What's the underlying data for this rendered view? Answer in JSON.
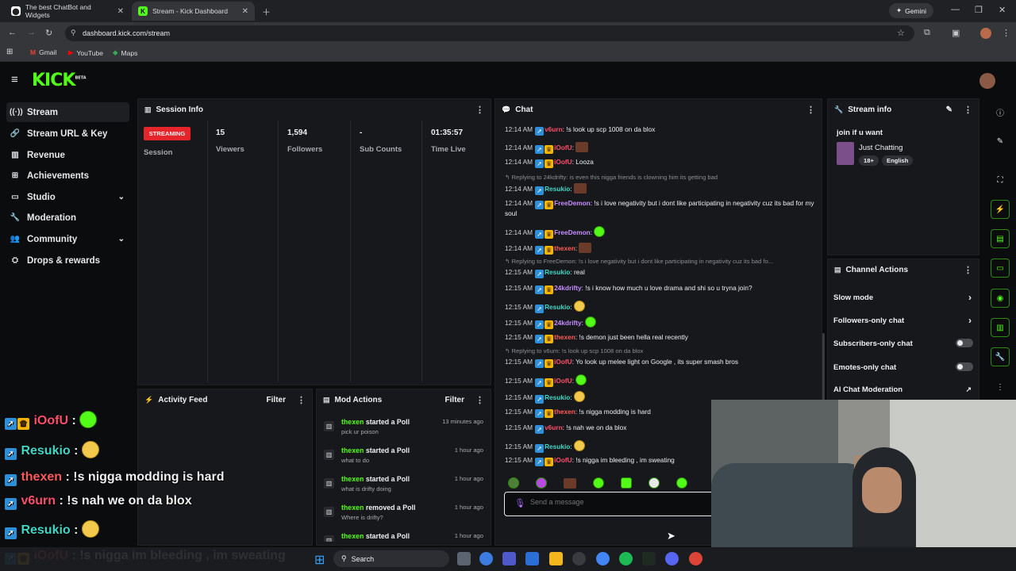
{
  "browser": {
    "tabs": [
      {
        "title": "The best ChatBot and Widgets",
        "active": false
      },
      {
        "title": "Stream - Kick Dashboard",
        "active": true
      }
    ],
    "gemini_label": "Gemini",
    "url": "dashboard.kick.com/stream",
    "bookmarks": [
      "Gmail",
      "YouTube",
      "Maps"
    ]
  },
  "kick": {
    "logo": "KICK",
    "beta": "BETA"
  },
  "sidebar": {
    "items": [
      {
        "label": "Stream",
        "icon": "broadcast-icon",
        "glyph": "((·))",
        "active": true
      },
      {
        "label": "Stream URL & Key",
        "icon": "key-icon",
        "glyph": "🔗"
      },
      {
        "label": "Revenue",
        "icon": "chart-icon",
        "glyph": "▥"
      },
      {
        "label": "Achievements",
        "icon": "trophy-icon",
        "glyph": "⊞"
      },
      {
        "label": "Studio",
        "icon": "studio-icon",
        "glyph": "▭",
        "expandable": true
      },
      {
        "label": "Moderation",
        "icon": "wrench-icon",
        "glyph": "🔧"
      },
      {
        "label": "Community",
        "icon": "people-icon",
        "glyph": "👥",
        "expandable": true
      },
      {
        "label": "Drops & rewards",
        "icon": "gift-icon",
        "glyph": "⛭"
      }
    ]
  },
  "session": {
    "title": "Session Info",
    "status": "STREAMING",
    "status_label": "Session",
    "stats": [
      {
        "value": "15",
        "label": "Viewers"
      },
      {
        "value": "1,594",
        "label": "Followers"
      },
      {
        "value": "-",
        "label": "Sub Counts"
      },
      {
        "value": "01:35:57",
        "label": "Time Live"
      }
    ]
  },
  "activity": {
    "title": "Activity Feed",
    "filter": "Filter"
  },
  "mod_actions": {
    "title": "Mod Actions",
    "filter": "Filter",
    "items": [
      {
        "user": "thexen",
        "action": "started a Poll",
        "detail": "pick ur poison",
        "time": "13 minutes ago"
      },
      {
        "user": "thexen",
        "action": "started a Poll",
        "detail": "what to do",
        "time": "1 hour ago"
      },
      {
        "user": "thexen",
        "action": "started a Poll",
        "detail": "what is drifty doing",
        "time": "1 hour ago"
      },
      {
        "user": "thexen",
        "action": "removed a Poll",
        "detail": "Where is drifty?",
        "time": "1 hour ago"
      },
      {
        "user": "thexen",
        "action": "started a Poll",
        "detail": "",
        "time": "1 hour ago"
      }
    ]
  },
  "chat": {
    "title": "Chat",
    "placeholder": "Send a message",
    "messages": [
      {
        "time": "12:14 AM",
        "user": "v6urn",
        "color": "#ff4d6d",
        "crown": false,
        "text": "!s look up scp 1008 on da blox"
      },
      {
        "time": "12:14 AM",
        "user": "iOofU",
        "color": "#ff4d6d",
        "crown": true,
        "text": "",
        "emote": "photo"
      },
      {
        "time": "12:14 AM",
        "user": "iOofU",
        "color": "#ff4d6d",
        "crown": true,
        "text": "Looza"
      },
      {
        "reply": "Replying to 24kdrifty: is even this nigga friends is clowning him its getting bad"
      },
      {
        "time": "12:14 AM",
        "user": "Resukio",
        "color": "#3fd8c8",
        "crown": false,
        "text": "",
        "emote": "photo"
      },
      {
        "time": "12:14 AM",
        "user": "FreeDemon",
        "color": "#c58cff",
        "crown": true,
        "text": "!s i love negativity but i dont like participating in negativity cuz its bad for my soul"
      },
      {
        "time": "12:14 AM",
        "user": "FreeDemon",
        "color": "#c58cff",
        "crown": true,
        "text": "",
        "emote": "green"
      },
      {
        "time": "12:14 AM",
        "user": "thexen",
        "color": "#ff5a5a",
        "crown": true,
        "text": "",
        "emote": "photo"
      },
      {
        "reply": "Replying to FreeDemon: !s i love negativity but i dont like participating in negativity cuz its bad fo..."
      },
      {
        "time": "12:15 AM",
        "user": "Resukio",
        "color": "#3fd8c8",
        "crown": false,
        "text": "real"
      },
      {
        "time": "12:15 AM",
        "user": "24kdrifty",
        "color": "#c58cff",
        "crown": true,
        "text": "!s i know how much u love drama and shi so u tryna join?"
      },
      {
        "time": "12:15 AM",
        "user": "Resukio",
        "color": "#3fd8c8",
        "crown": false,
        "text": "",
        "emote": "yellow"
      },
      {
        "time": "12:15 AM",
        "user": "24kdrifty",
        "color": "#c58cff",
        "crown": true,
        "text": "",
        "emote": "green"
      },
      {
        "time": "12:15 AM",
        "user": "thexen",
        "color": "#ff5a5a",
        "crown": true,
        "text": "!s demon just been hella real recently"
      },
      {
        "reply": "Replying to v6urn: !s look up scp 1008 on da blox"
      },
      {
        "time": "12:15 AM",
        "user": "iOofU",
        "color": "#ff4d6d",
        "crown": true,
        "text": "Yo look up melee light on Google , its super smash bros"
      },
      {
        "time": "12:15 AM",
        "user": "iOofU",
        "color": "#ff4d6d",
        "crown": true,
        "text": "",
        "emote": "green"
      },
      {
        "time": "12:15 AM",
        "user": "Resukio",
        "color": "#3fd8c8",
        "crown": false,
        "text": "",
        "emote": "yellow"
      },
      {
        "time": "12:15 AM",
        "user": "thexen",
        "color": "#ff5a5a",
        "crown": true,
        "text": "!s nigga modding is hard"
      },
      {
        "time": "12:15 AM",
        "user": "v6urn",
        "color": "#ff4d6d",
        "crown": false,
        "text": "!s nah we on da blox"
      },
      {
        "time": "12:15 AM",
        "user": "Resukio",
        "color": "#3fd8c8",
        "crown": false,
        "text": "",
        "emote": "yellow"
      },
      {
        "time": "12:15 AM",
        "user": "iOofU",
        "color": "#ff4d6d",
        "crown": true,
        "text": "!s nigga im bleeding , im sweating"
      }
    ]
  },
  "stream_info": {
    "title": "Stream info",
    "stream_title": "join if u want",
    "category": "Just Chatting",
    "tags": [
      "18+",
      "English"
    ]
  },
  "channel_actions": {
    "title": "Channel Actions",
    "rows": [
      {
        "label": "Slow mode",
        "kind": "chevron"
      },
      {
        "label": "Followers-only chat",
        "kind": "chevron"
      },
      {
        "label": "Subscribers-only chat",
        "kind": "toggle",
        "on": false
      },
      {
        "label": "Emotes-only chat",
        "kind": "toggle",
        "on": false
      },
      {
        "label": "AI Chat Moderation",
        "kind": "link"
      }
    ]
  },
  "overlay": [
    {
      "user": "iOofU",
      "color": "#ff4d6d",
      "crown": true,
      "text": "",
      "emote": "green"
    },
    {
      "user": "Resukio",
      "color": "#3fd8c8",
      "crown": false,
      "text": "",
      "emote": "yellow"
    },
    {
      "user": "thexen",
      "color": "#ff5a5a",
      "crown": false,
      "text": "!s nigga modding is hard"
    },
    {
      "user": "v6urn",
      "color": "#ff4d6d",
      "crown": false,
      "text": "!s nah we on da blox"
    },
    {
      "user": "Resukio",
      "color": "#3fd8c8",
      "crown": false,
      "text": "",
      "emote": "yellow"
    },
    {
      "user": "iOofU",
      "color": "#ff4d6d",
      "crown": true,
      "text": "!s nigga im bleeding , im sweating"
    }
  ],
  "taskbar": {
    "search_placeholder": "Search"
  },
  "colors": {
    "accent": "#53fc18",
    "streaming": "#e5252a"
  }
}
